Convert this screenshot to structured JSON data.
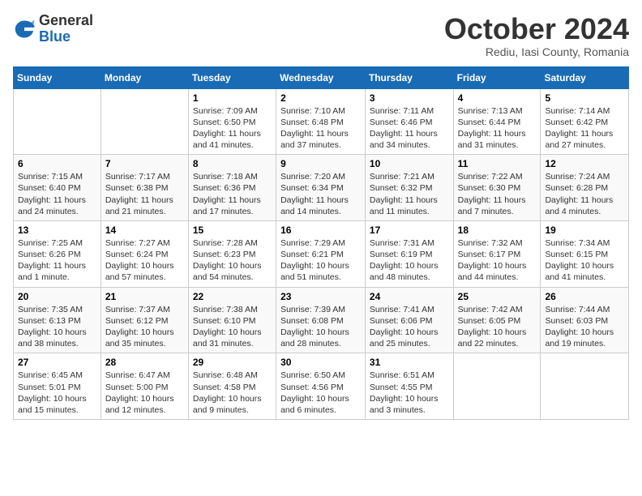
{
  "logo": {
    "general": "General",
    "blue": "Blue"
  },
  "title": "October 2024",
  "location": "Rediu, Iasi County, Romania",
  "days_of_week": [
    "Sunday",
    "Monday",
    "Tuesday",
    "Wednesday",
    "Thursday",
    "Friday",
    "Saturday"
  ],
  "weeks": [
    [
      {
        "day": "",
        "content": ""
      },
      {
        "day": "",
        "content": ""
      },
      {
        "day": "1",
        "content": "Sunrise: 7:09 AM\nSunset: 6:50 PM\nDaylight: 11 hours and 41 minutes."
      },
      {
        "day": "2",
        "content": "Sunrise: 7:10 AM\nSunset: 6:48 PM\nDaylight: 11 hours and 37 minutes."
      },
      {
        "day": "3",
        "content": "Sunrise: 7:11 AM\nSunset: 6:46 PM\nDaylight: 11 hours and 34 minutes."
      },
      {
        "day": "4",
        "content": "Sunrise: 7:13 AM\nSunset: 6:44 PM\nDaylight: 11 hours and 31 minutes."
      },
      {
        "day": "5",
        "content": "Sunrise: 7:14 AM\nSunset: 6:42 PM\nDaylight: 11 hours and 27 minutes."
      }
    ],
    [
      {
        "day": "6",
        "content": "Sunrise: 7:15 AM\nSunset: 6:40 PM\nDaylight: 11 hours and 24 minutes."
      },
      {
        "day": "7",
        "content": "Sunrise: 7:17 AM\nSunset: 6:38 PM\nDaylight: 11 hours and 21 minutes."
      },
      {
        "day": "8",
        "content": "Sunrise: 7:18 AM\nSunset: 6:36 PM\nDaylight: 11 hours and 17 minutes."
      },
      {
        "day": "9",
        "content": "Sunrise: 7:20 AM\nSunset: 6:34 PM\nDaylight: 11 hours and 14 minutes."
      },
      {
        "day": "10",
        "content": "Sunrise: 7:21 AM\nSunset: 6:32 PM\nDaylight: 11 hours and 11 minutes."
      },
      {
        "day": "11",
        "content": "Sunrise: 7:22 AM\nSunset: 6:30 PM\nDaylight: 11 hours and 7 minutes."
      },
      {
        "day": "12",
        "content": "Sunrise: 7:24 AM\nSunset: 6:28 PM\nDaylight: 11 hours and 4 minutes."
      }
    ],
    [
      {
        "day": "13",
        "content": "Sunrise: 7:25 AM\nSunset: 6:26 PM\nDaylight: 11 hours and 1 minute."
      },
      {
        "day": "14",
        "content": "Sunrise: 7:27 AM\nSunset: 6:24 PM\nDaylight: 10 hours and 57 minutes."
      },
      {
        "day": "15",
        "content": "Sunrise: 7:28 AM\nSunset: 6:23 PM\nDaylight: 10 hours and 54 minutes."
      },
      {
        "day": "16",
        "content": "Sunrise: 7:29 AM\nSunset: 6:21 PM\nDaylight: 10 hours and 51 minutes."
      },
      {
        "day": "17",
        "content": "Sunrise: 7:31 AM\nSunset: 6:19 PM\nDaylight: 10 hours and 48 minutes."
      },
      {
        "day": "18",
        "content": "Sunrise: 7:32 AM\nSunset: 6:17 PM\nDaylight: 10 hours and 44 minutes."
      },
      {
        "day": "19",
        "content": "Sunrise: 7:34 AM\nSunset: 6:15 PM\nDaylight: 10 hours and 41 minutes."
      }
    ],
    [
      {
        "day": "20",
        "content": "Sunrise: 7:35 AM\nSunset: 6:13 PM\nDaylight: 10 hours and 38 minutes."
      },
      {
        "day": "21",
        "content": "Sunrise: 7:37 AM\nSunset: 6:12 PM\nDaylight: 10 hours and 35 minutes."
      },
      {
        "day": "22",
        "content": "Sunrise: 7:38 AM\nSunset: 6:10 PM\nDaylight: 10 hours and 31 minutes."
      },
      {
        "day": "23",
        "content": "Sunrise: 7:39 AM\nSunset: 6:08 PM\nDaylight: 10 hours and 28 minutes."
      },
      {
        "day": "24",
        "content": "Sunrise: 7:41 AM\nSunset: 6:06 PM\nDaylight: 10 hours and 25 minutes."
      },
      {
        "day": "25",
        "content": "Sunrise: 7:42 AM\nSunset: 6:05 PM\nDaylight: 10 hours and 22 minutes."
      },
      {
        "day": "26",
        "content": "Sunrise: 7:44 AM\nSunset: 6:03 PM\nDaylight: 10 hours and 19 minutes."
      }
    ],
    [
      {
        "day": "27",
        "content": "Sunrise: 6:45 AM\nSunset: 5:01 PM\nDaylight: 10 hours and 15 minutes."
      },
      {
        "day": "28",
        "content": "Sunrise: 6:47 AM\nSunset: 5:00 PM\nDaylight: 10 hours and 12 minutes."
      },
      {
        "day": "29",
        "content": "Sunrise: 6:48 AM\nSunset: 4:58 PM\nDaylight: 10 hours and 9 minutes."
      },
      {
        "day": "30",
        "content": "Sunrise: 6:50 AM\nSunset: 4:56 PM\nDaylight: 10 hours and 6 minutes."
      },
      {
        "day": "31",
        "content": "Sunrise: 6:51 AM\nSunset: 4:55 PM\nDaylight: 10 hours and 3 minutes."
      },
      {
        "day": "",
        "content": ""
      },
      {
        "day": "",
        "content": ""
      }
    ]
  ]
}
